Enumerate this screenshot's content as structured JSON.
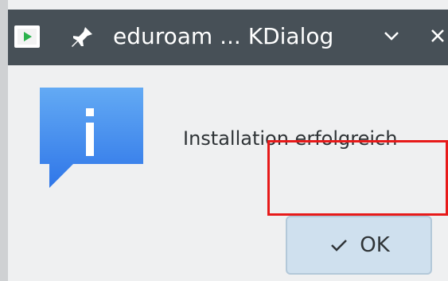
{
  "window": {
    "title": "eduroam ... KDialog",
    "icons": {
      "app": "app-run-icon",
      "pin": "pin-icon",
      "chevron": "chevron-down-icon",
      "close": "close-icon"
    }
  },
  "dialog": {
    "icon": "info-icon",
    "message": "Installation erfolgreich",
    "ok_label": "OK",
    "ok_icon": "check-icon"
  },
  "colors": {
    "titlebar": "#475057",
    "accent_button": "#cfe0ee",
    "info_blue": "#3c7ff0",
    "highlight_red": "#e71a1a"
  }
}
